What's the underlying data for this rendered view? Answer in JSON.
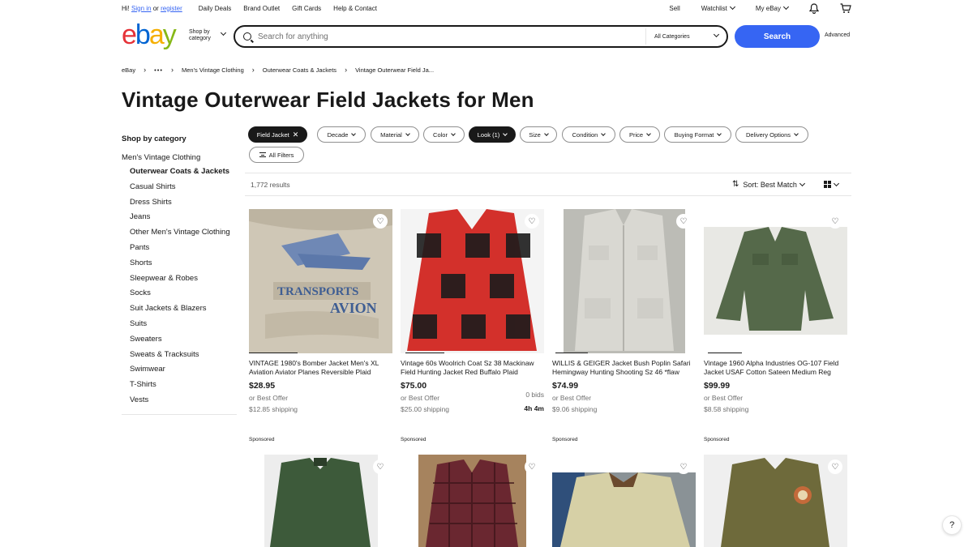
{
  "topbar": {
    "greeting": "Hi!",
    "sign_in": "Sign in",
    "or": "or",
    "register": "register",
    "links": [
      "Daily Deals",
      "Brand Outlet",
      "Gift Cards",
      "Help & Contact"
    ],
    "sell": "Sell",
    "watchlist": "Watchlist",
    "my_ebay": "My eBay"
  },
  "header": {
    "logo": {
      "e": "e",
      "b": "b",
      "a": "a",
      "y": "y"
    },
    "shop_by_line1": "Shop by",
    "shop_by_line2": "category",
    "search_placeholder": "Search for anything",
    "category_select": "All Categories",
    "search_button": "Search",
    "advanced": "Advanced"
  },
  "breadcrumb": {
    "root": "eBay",
    "ellipsis": "•••",
    "items": [
      "Men's Vintage Clothing",
      "Outerwear Coats & Jackets",
      "Vintage Outerwear Field Ja..."
    ]
  },
  "page_title": "Vintage Outerwear Field Jackets for Men",
  "sidebar": {
    "heading": "Shop by category",
    "parent": "Men's Vintage Clothing",
    "items": [
      "Outerwear Coats & Jackets",
      "Casual Shirts",
      "Dress Shirts",
      "Jeans",
      "Other Men's Vintage Clothing",
      "Pants",
      "Shorts",
      "Sleepwear & Robes",
      "Socks",
      "Suit Jackets & Blazers",
      "Suits",
      "Sweaters",
      "Sweats & Tracksuits",
      "Swimwear",
      "T-Shirts",
      "Vests"
    ]
  },
  "filters": {
    "active": "Field Jacket",
    "pills": [
      "Decade",
      "Material",
      "Color",
      "Look (1)",
      "Size",
      "Condition",
      "Price",
      "Buying Format",
      "Delivery Options"
    ],
    "all_filters": "All Filters"
  },
  "results": {
    "count": "1,772 results",
    "sort": "Sort: Best Match"
  },
  "listings": [
    {
      "title": "VINTAGE 1980's Bomber Jacket Men's XL Aviation Aviator Planes Reversible Plaid",
      "price": "$28.95",
      "offer": "or Best Offer",
      "shipping": "$12.85 shipping",
      "sponsored": "Sponsored"
    },
    {
      "title": "Vintage 60s Woolrich Coat Sz 38 Mackinaw Field Hunting Jacket Red Buffalo Plaid",
      "price": "$75.00",
      "bids": "0 bids",
      "offer": "or Best Offer",
      "time_left": "4h 4m",
      "shipping": "$25.00 shipping",
      "sponsored": "Sponsored"
    },
    {
      "title": "WILLIS & GEIGER Jacket Bush Poplin Safari Hemingway Hunting Shooting Sz 46 *flaw",
      "price": "$74.99",
      "offer": "or Best Offer",
      "shipping": "$9.06 shipping",
      "sponsored": "Sponsored"
    },
    {
      "title": "Vintage 1960 Alpha Industries OG-107 Field Jacket USAF Cotton Sateen Medium Reg",
      "price": "$99.99",
      "offer": "or Best Offer",
      "shipping": "$8.58 shipping",
      "sponsored": "Sponsored"
    }
  ],
  "help": "?"
}
